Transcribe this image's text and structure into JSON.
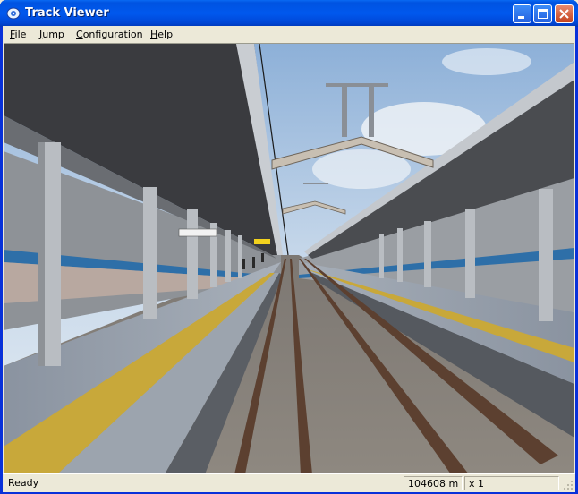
{
  "window": {
    "title": "Track Viewer",
    "icon": "track-viewer-app-icon"
  },
  "menu": {
    "items": [
      {
        "label_u": "F",
        "label_rest": "ile"
      },
      {
        "label_u": "J",
        "label_rest": "ump"
      },
      {
        "label_u": "C",
        "label_rest": "onfiguration"
      },
      {
        "label_u": "H",
        "label_rest": "elp"
      }
    ]
  },
  "scene": {
    "description_icon": "3d-train-track-view"
  },
  "status": {
    "state": "Ready",
    "distance": "104608 m",
    "speed_multiplier": "x 1"
  },
  "colors": {
    "titlebar": "#0058EE",
    "chrome": "#ECE9D8",
    "close_button": "#C4431E"
  }
}
